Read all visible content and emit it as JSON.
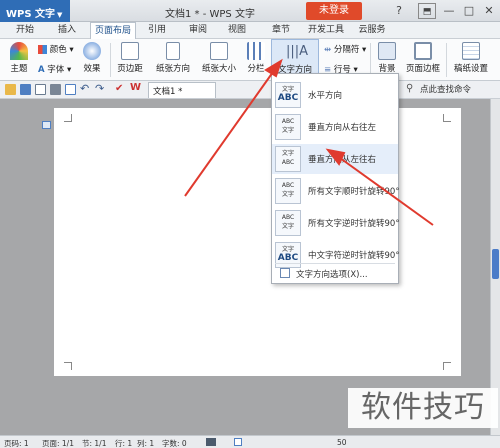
{
  "app": {
    "brand": "WPS 文字",
    "doc_title": "文档1 * - WPS 文字",
    "login": "未登录"
  },
  "window_controls": [
    "?",
    "—",
    "□",
    "✕"
  ],
  "menu_tabs": [
    "开始",
    "插入",
    "页面布局",
    "引用",
    "审阅",
    "视图",
    "章节",
    "开发工具",
    "云服务"
  ],
  "ribbon": {
    "theme": "主题",
    "colors": "颜色",
    "font": "字体",
    "effects": "效果",
    "margins": "页边距",
    "orientation": "纸张方向",
    "size": "纸张大小",
    "columns": "分栏",
    "text_direction": "文字方向",
    "breaks": "分隔符",
    "line_numbers": "行号",
    "background": "背景",
    "page_border": "页面边框",
    "manuscript": "稿纸设置"
  },
  "quickbar": {
    "doc_tab": "文档1 *",
    "search": "点此查找命令"
  },
  "dropdown": {
    "items": [
      {
        "label": "水平方向",
        "icon_text": "文字 ABC"
      },
      {
        "label": "垂直方向从右往左",
        "icon_text": "ABC 文字"
      },
      {
        "label": "垂直方向从左往右",
        "icon_text": "文字 ABC"
      },
      {
        "label": "所有文字顺时针旋转90°",
        "icon_text": "ABC 文字"
      },
      {
        "label": "所有文字逆时针旋转90°",
        "icon_text": "ABC 文字"
      },
      {
        "label": "中文字符逆时针旋转90°",
        "icon_text": "文字 ABC"
      }
    ],
    "footer": "文字方向选项(X)..."
  },
  "statusbar": {
    "page": "页码: 1",
    "pages": "页面: 1/1",
    "section": "节: 1/1",
    "row": "行: 1",
    "col": "列: 1",
    "words": "字数: 0",
    "zoom": "50"
  },
  "watermark": "软件技巧",
  "colors": {
    "brand_blue": "#2f6db6",
    "login_red": "#e04a2a",
    "arrow_red": "#e03a2e"
  }
}
